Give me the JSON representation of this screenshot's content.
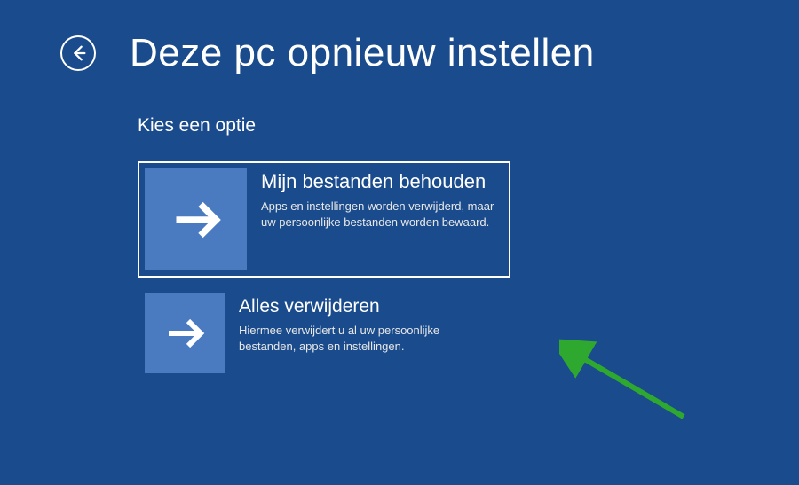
{
  "colors": {
    "background": "#1a4b8c",
    "tile_icon_bg": "#4a7bc0",
    "annotation_arrow": "#2fa82f"
  },
  "header": {
    "title": "Deze pc opnieuw instellen"
  },
  "subtitle": "Kies een optie",
  "options": [
    {
      "title": "Mijn bestanden behouden",
      "description": "Apps en instellingen worden verwijderd, maar uw persoonlijke bestanden worden bewaard.",
      "selected": true
    },
    {
      "title": "Alles verwijderen",
      "description": "Hiermee verwijdert u al uw persoonlijke bestanden, apps en instellingen.",
      "selected": false
    }
  ]
}
